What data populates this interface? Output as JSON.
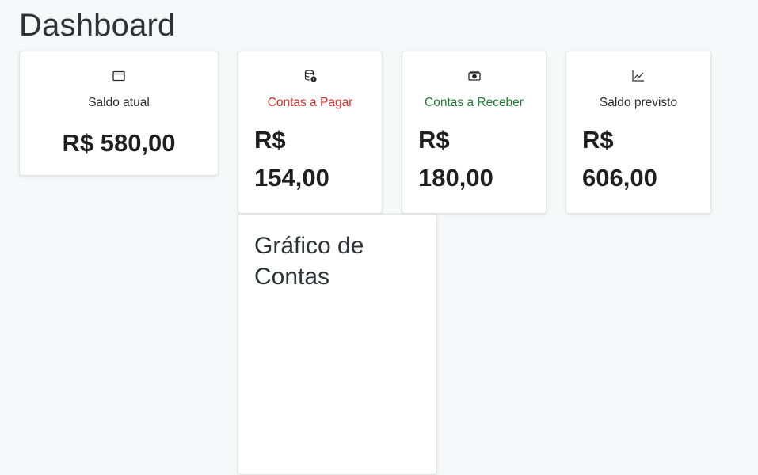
{
  "page": {
    "title": "Dashboard"
  },
  "cards": [
    {
      "icon": "wallet-icon",
      "label": "Saldo atual",
      "value": "R$ 580,00",
      "label_color": "#2b2b2b"
    },
    {
      "icon": "database-coin-icon",
      "label": "Contas a Pagar",
      "value_line1": "R$",
      "value_line2": "154,00",
      "label_color": "#e02b2b"
    },
    {
      "icon": "cash-icon",
      "label": "Contas a Receber",
      "value_line1": "R$",
      "value_line2": "180,00",
      "label_color": "#1e7d32"
    },
    {
      "icon": "trend-chart-icon",
      "label": "Saldo previsto",
      "value_line1": "R$",
      "value_line2": "606,00",
      "label_color": "#2b2b2b"
    }
  ],
  "chart_card": {
    "title": "Gráfico de Contas"
  }
}
